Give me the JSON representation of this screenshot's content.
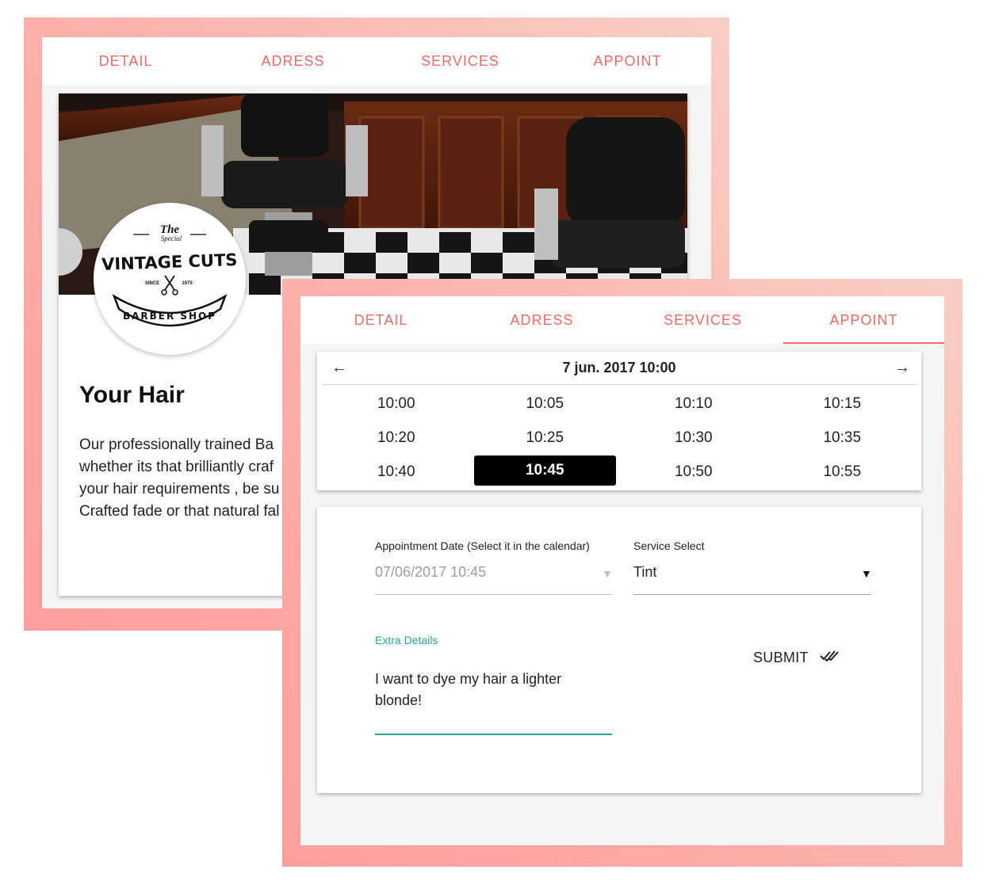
{
  "colors": {
    "accent": "#ef6a6a",
    "frame_gradient": [
      "#ff9e9e",
      "#f8cfc3"
    ],
    "teal": "#26a69a",
    "selected_time_bg": "#000000"
  },
  "back_screen": {
    "tabs": [
      {
        "label": "DETAIL"
      },
      {
        "label": "ADRESS"
      },
      {
        "label": "SERVICES"
      },
      {
        "label": "APPOINT"
      }
    ],
    "logo": {
      "the": "The",
      "special": "Special",
      "name": "VINTAGE CUTS",
      "since": "SINCE",
      "year": "1975",
      "subtitle": "BARBER SHOP",
      "icon": "scissors-icon"
    },
    "section_title": "Your Hair",
    "section_lines": [
      "Our professionally trained Ba",
      "whether its that brilliantly craf",
      "your hair requirements , be su",
      "Crafted fade or that natural fal"
    ]
  },
  "front_screen": {
    "tabs": [
      {
        "label": "DETAIL"
      },
      {
        "label": "ADRESS"
      },
      {
        "label": "SERVICES"
      },
      {
        "label": "APPOINT",
        "active": true
      }
    ],
    "calendar": {
      "title": "7 jun. 2017 10:00",
      "prev_icon": "←",
      "next_icon": "→",
      "times": [
        "10:00",
        "10:05",
        "10:10",
        "10:15",
        "10:20",
        "10:25",
        "10:30",
        "10:35",
        "10:40",
        "10:45",
        "10:50",
        "10:55"
      ],
      "selected": "10:45"
    },
    "form": {
      "date_label": "Appointment Date (Select it in the calendar)",
      "date_value": "07/06/2017 10:45",
      "date_caret": "▼",
      "service_label": "Service Select",
      "service_value": "Tint",
      "service_caret": "▼",
      "details_label": "Extra Details",
      "details_lines": [
        "I want to dye my hair a lighter",
        "blonde!"
      ],
      "submit_label": "SUBMIT",
      "submit_icon": "double-check-icon"
    }
  }
}
